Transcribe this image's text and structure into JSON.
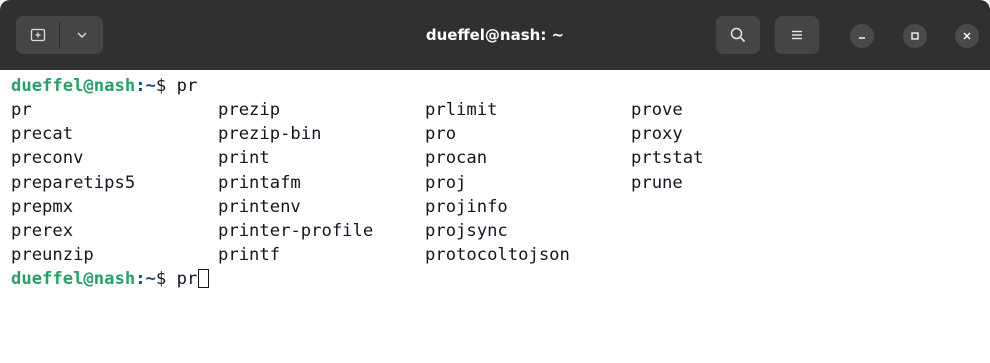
{
  "window": {
    "title": "dueffel@nash: ~"
  },
  "titlebar": {
    "new_tab_icon": "new-tab-icon",
    "tab_menu_icon": "chevron-down-icon",
    "search_icon": "search-icon",
    "menu_icon": "hamburger-menu-icon",
    "minimize_icon": "minimize-icon",
    "maximize_icon": "maximize-icon",
    "close_icon": "close-icon"
  },
  "terminal": {
    "prompt_user": "dueffel@nash",
    "prompt_path": ":~",
    "prompt_symbol": "$ ",
    "first_command": "pr",
    "second_command": "pr",
    "completions": {
      "col1": [
        "pr",
        "precat",
        "preconv",
        "preparetips5",
        "prepmx",
        "prerex",
        "preunzip"
      ],
      "col2": [
        "prezip",
        "prezip-bin",
        "print",
        "printafm",
        "printenv",
        "printer-profile",
        "printf"
      ],
      "col3": [
        "prlimit",
        "pro",
        "procan",
        "proj",
        "projinfo",
        "projsync",
        "protocoltojson"
      ],
      "col4": [
        "prove",
        "proxy",
        "prtstat",
        "prune"
      ]
    }
  },
  "colors": {
    "titlebar": "#303030",
    "terminal_bg": "#ffffff",
    "text": "#171421",
    "prompt_user": "#26a269",
    "prompt_path": "#12488b"
  }
}
